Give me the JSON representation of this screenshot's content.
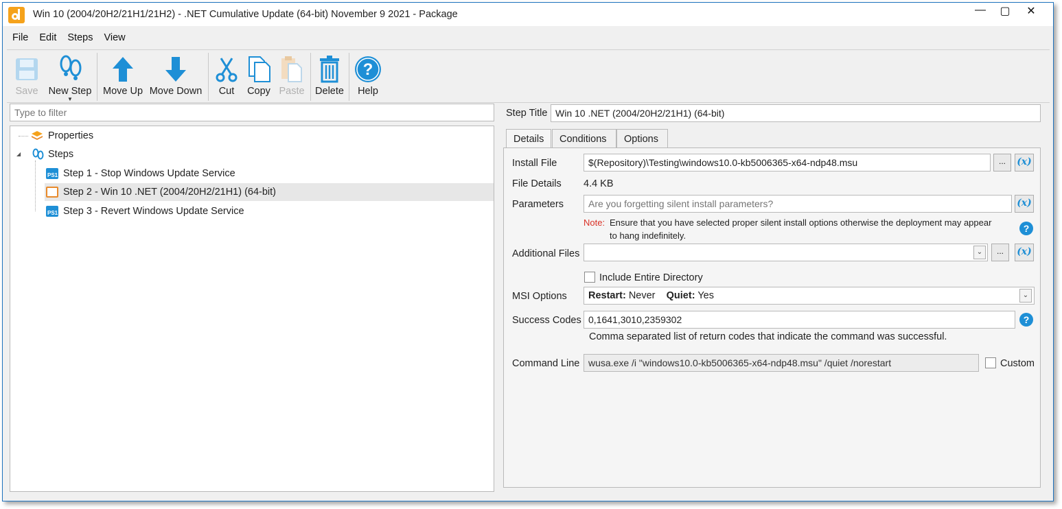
{
  "window": {
    "title": "Win 10 (2004/20H2/21H1/21H2) - .NET Cumulative Update (64-bit) November 9 2021 - Package"
  },
  "menu": [
    "File",
    "Edit",
    "Steps",
    "View"
  ],
  "toolbar": {
    "save": "Save",
    "new_step": "New Step",
    "move_up": "Move Up",
    "move_down": "Move Down",
    "cut": "Cut",
    "copy": "Copy",
    "paste": "Paste",
    "delete": "Delete",
    "help": "Help"
  },
  "filter": {
    "placeholder": "Type to filter"
  },
  "tree": {
    "properties": "Properties",
    "steps": "Steps",
    "items": [
      {
        "label": "Step 1 - Stop Windows Update Service"
      },
      {
        "label": "Step 2 - Win 10 .NET (2004/20H2/21H1) (64-bit)"
      },
      {
        "label": "Step 3 - Revert Windows Update Service"
      }
    ]
  },
  "step": {
    "title_label": "Step Title",
    "title_value": "Win 10 .NET (2004/20H2/21H1) (64-bit)"
  },
  "tabs": [
    "Details",
    "Conditions",
    "Options"
  ],
  "details": {
    "install_file_label": "Install File",
    "install_file_value": "$(Repository)\\Testing\\windows10.0-kb5006365-x64-ndp48.msu",
    "file_details_label": "File Details",
    "file_details_value": "4.4 KB",
    "parameters_label": "Parameters",
    "parameters_placeholder": "Are you forgetting silent install parameters?",
    "note_label": "Note:",
    "note_line1": "Ensure that you have selected proper silent install options otherwise the deployment may appear",
    "note_line2": "to hang indefinitely.",
    "additional_files_label": "Additional Files",
    "include_dir_label": "Include Entire Directory",
    "msi_options_label": "MSI Options",
    "msi_restart_label": "Restart:",
    "msi_restart_value": "Never",
    "msi_quiet_label": "Quiet:",
    "msi_quiet_value": "Yes",
    "success_codes_label": "Success Codes",
    "success_codes_value": "0,1641,3010,2359302",
    "success_codes_hint": "Comma separated list of return codes that indicate the command was successful.",
    "command_line_label": "Command Line",
    "command_line_value": "wusa.exe /i \"windows10.0-kb5006365-x64-ndp48.msu\" /quiet /norestart",
    "custom_label": "Custom",
    "dots": "...",
    "var_button": "(x)",
    "help_glyph": "?"
  },
  "colors": {
    "accent": "#1e8fd6",
    "note": "#d93025",
    "logo": "#f5a21b"
  }
}
